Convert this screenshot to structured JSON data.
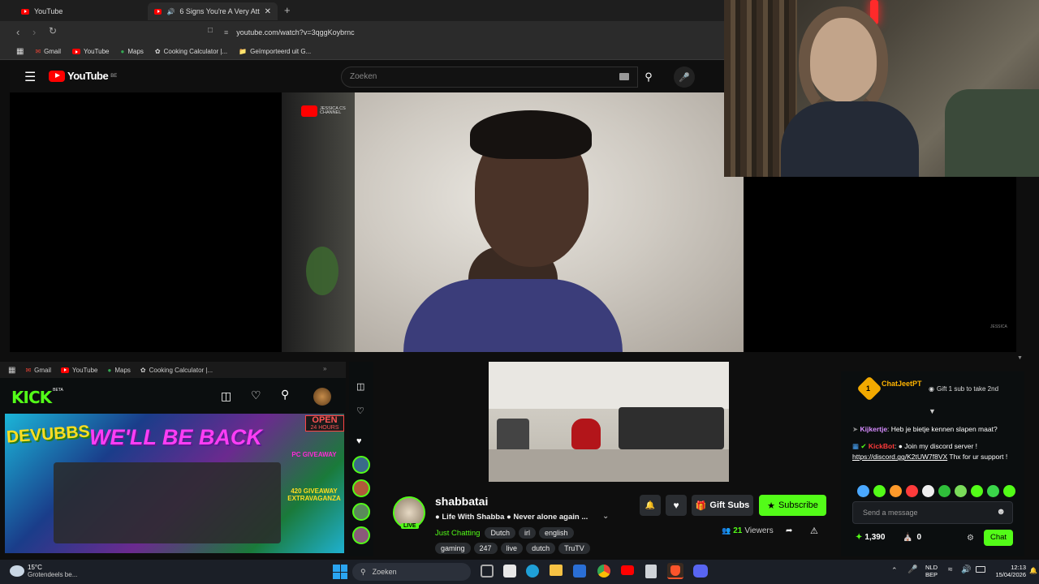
{
  "browser": {
    "tabs": [
      {
        "label": "YouTube"
      },
      {
        "label": "6 Signs You're A Very Attracti"
      }
    ],
    "new_tab": "+",
    "url": "youtube.com/watch?v=3qggKoybrnc",
    "bookmarks": [
      "Gmail",
      "YouTube",
      "Maps",
      "Cooking Calculator |...",
      "Geïmporteerd uit G..."
    ]
  },
  "youtube": {
    "logo": "YouTube",
    "region": "BE",
    "search_placeholder": "Zoeken",
    "video_badge": "JESSICA CS CHANNEL",
    "watermark": "JESSICA"
  },
  "kick": {
    "bookmarks": [
      "Gmail",
      "YouTube",
      "Maps",
      "Cooking Calculator |..."
    ],
    "logo": "KICK",
    "logo_badge": "BETA",
    "thumb_text": {
      "brand": "DEVUBBS",
      "headline": "WE'LL BE BACK",
      "open": "OPEN",
      "hours": "24 HOURS",
      "giveaway1": "PC GIVEAWAY",
      "giveaway2": "420 GIVEAWAY EXTRAVAGANZA"
    },
    "streamer": "shabbatai",
    "live_label": "LIVE",
    "stream_title": "● Life With Shabba ●  Never alone again ...",
    "category": "Just Chatting",
    "tags_row1": [
      "Dutch",
      "irl",
      "english"
    ],
    "tags_row2": [
      "gaming",
      "247",
      "live",
      "dutch",
      "TruTV"
    ],
    "gift_subs": "Gift Subs",
    "subscribe": "Subscribe",
    "viewers": "21",
    "viewers_label": "Viewers"
  },
  "chat": {
    "pinned_user": "ChatJeetPT",
    "pinned_level": "1",
    "gift_text": "Gift 1 sub to take 2nd",
    "messages": [
      {
        "user": "Kijkertje",
        "text": "Heb je bietje kennen slapen maat?",
        "color": "#d68cff"
      },
      {
        "user": "KickBot",
        "text": "Join my discord server !",
        "color": "#ff3b3b",
        "link": "https://discord.gg/K2tUW7f8VX",
        "tail": "Thx for ur support !"
      }
    ],
    "input_placeholder": "Send a message",
    "points": "1,390",
    "gifts": "0",
    "chat_button": "Chat"
  },
  "taskbar": {
    "weather_temp": "15°C",
    "weather_desc": "Grotendeels be...",
    "search_placeholder": "Zoeken",
    "lang1": "NLD",
    "lang2": "BEP",
    "time": "12:13",
    "date": "15/04/2026"
  },
  "colors": {
    "kick_green": "#53fc18",
    "yt_red": "#ff0000"
  }
}
